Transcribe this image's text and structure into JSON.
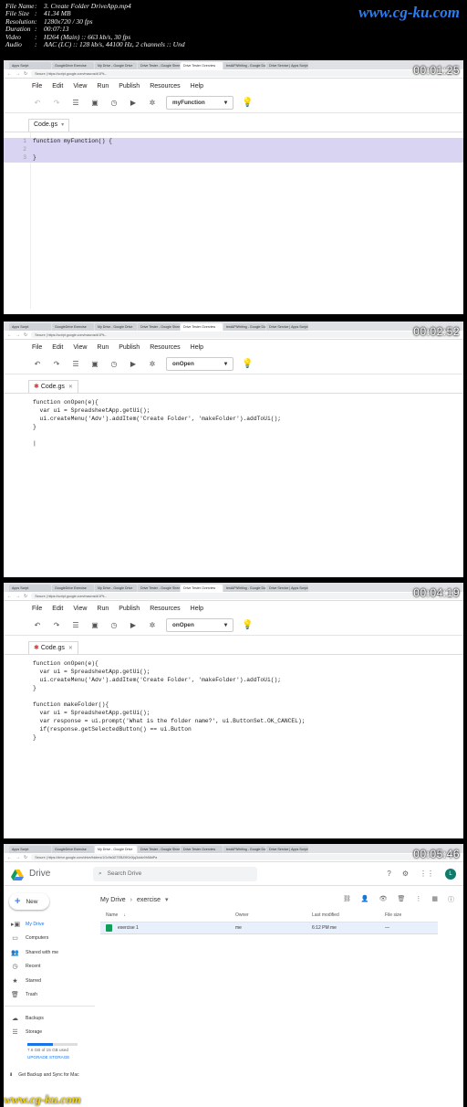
{
  "info": {
    "rows": [
      {
        "key": "File Name",
        "val": "3. Create Folder DriveApp.mp4"
      },
      {
        "key": "File Size",
        "val": "41.34 MB"
      },
      {
        "key": "Resolution",
        "val": "1280x720 / 30 fps"
      },
      {
        "key": "Duration",
        "val": "00:07:13"
      },
      {
        "key": "Video",
        "val": "H264 (Main) :: 663 kb/s, 30 fps"
      },
      {
        "key": "Audio",
        "val": "AAC (LC) :: 128 kb/s, 44100 Hz, 2 channels :: Und"
      }
    ],
    "watermark": "www.cg-ku.com"
  },
  "browser": {
    "tabs": [
      "Apps Script",
      "GoogleDrive Exercise",
      "My Drive - Google Drive",
      "Drive Tester - Google Sheets",
      "Drive Tester Overview",
      "testAPIWriting - Google Docs",
      "Drive Service | Apps Script"
    ],
    "url_editor": "Secure | https://script.google.com/macros/d/1Pk...",
    "url_drive": "Secure | https://drive.google.com/drive/folders/1Gx9s0i2TEBZl9Gr0ijq3ukkr0h58dPa"
  },
  "editor": {
    "menu": [
      "File",
      "Edit",
      "View",
      "Run",
      "Publish",
      "Resources",
      "Help"
    ],
    "file_tab": "Code.gs"
  },
  "frames": [
    {
      "timestamp": "00:01:25",
      "function": "myFunction",
      "lines": [
        "1",
        "2",
        "3"
      ],
      "code": [
        "function myFunction() {",
        "  ",
        "}"
      ]
    },
    {
      "timestamp": "00:02:52",
      "function": "onOpen",
      "code": [
        "function onOpen(e){",
        "  var ui = SpreadsheetApp.getUi();",
        "  ui.createMenu('Adv').addItem('Create Folder', 'makeFolder').addToUi();",
        "}",
        "",
        "|"
      ]
    },
    {
      "timestamp": "00:04:19",
      "function": "onOpen",
      "code": [
        "function onOpen(e){",
        "  var ui = SpreadsheetApp.getUi();",
        "  ui.createMenu('Adv').addItem('Create Folder', 'makeFolder').addToUi();",
        "}",
        "",
        "function makeFolder(){",
        "  var ui = SpreadsheetApp.getUi();",
        "  var response = ui.prompt('What is the folder name?', ui.ButtonSet.OK_CANCEL);",
        "  if(response.getSelectedButton() == ui.Button",
        "}",
        "",
        ""
      ]
    },
    {
      "timestamp": "00:05:46"
    }
  ],
  "drive": {
    "title": "Drive",
    "search_placeholder": "Search Drive",
    "avatar": "L",
    "new_label": "New",
    "nav": [
      "My Drive",
      "Computers",
      "Shared with me",
      "Recent",
      "Starred",
      "Trash",
      "Backups",
      "Storage"
    ],
    "storage_text": "7.6 GB of 15 GB used",
    "storage_fraction": 0.51,
    "upgrade": "UPGRADE STORAGE",
    "backup_label": "Get Backup and Sync for Mac",
    "breadcrumb_root": "My Drive",
    "breadcrumb_folder": "exercise",
    "columns": [
      "Name",
      "Owner",
      "Last modified",
      "File size"
    ],
    "rows": [
      {
        "name": "exercise 1",
        "owner": "me",
        "modified": "6:12 PM me",
        "size": "—"
      }
    ]
  },
  "bottom_watermark": "www.cg-ku.com"
}
